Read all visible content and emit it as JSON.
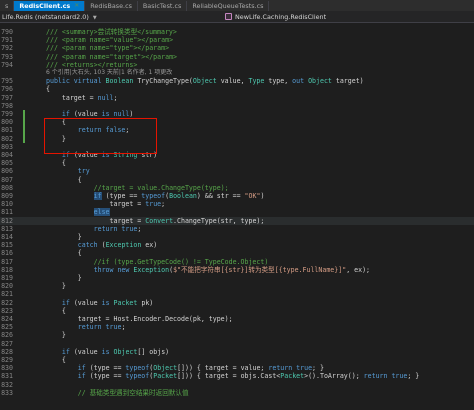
{
  "tabs": [
    {
      "label": "s",
      "active": false
    },
    {
      "label": "RedisClient.cs",
      "active": true
    },
    {
      "label": "RedisBase.cs",
      "active": false
    },
    {
      "label": "BasicTest.cs",
      "active": false
    },
    {
      "label": "ReliableQueueTests.cs",
      "active": false
    }
  ],
  "nav": {
    "project": "Life.Redis (netstandard2.0)",
    "member": "NewLife.Caching.RedisClient"
  },
  "codelens": "6 个引用|大石头, 103 天前|1 名作者, 1 项更改",
  "lines": [
    {
      "n": "790",
      "segs": [
        [
          "c",
          "/// <summary>尝试转换类型</summary>"
        ]
      ]
    },
    {
      "n": "791",
      "segs": [
        [
          "c",
          "/// <param name=\"value\"></param>"
        ]
      ]
    },
    {
      "n": "792",
      "segs": [
        [
          "c",
          "/// <param name=\"type\"></param>"
        ]
      ]
    },
    {
      "n": "793",
      "segs": [
        [
          "c",
          "/// <param name=\"target\"></param>"
        ]
      ]
    },
    {
      "n": "794",
      "segs": [
        [
          "c",
          "/// <returns></returns>"
        ]
      ]
    },
    {
      "n": "",
      "segs": []
    },
    {
      "n": "795",
      "segs": [
        [
          "k",
          "public virtual "
        ],
        [
          "t",
          "Boolean"
        ],
        [
          "p",
          " TryChangeType("
        ],
        [
          "t",
          "Object"
        ],
        [
          "p",
          " value, "
        ],
        [
          "t",
          "Type"
        ],
        [
          "p",
          " type, "
        ],
        [
          "k",
          "out "
        ],
        [
          "t",
          "Object"
        ],
        [
          "p",
          " target)"
        ]
      ]
    },
    {
      "n": "796",
      "segs": [
        [
          "p",
          "{"
        ]
      ]
    },
    {
      "n": "797",
      "segs": [
        [
          "p",
          "    target = "
        ],
        [
          "k",
          "null"
        ],
        [
          "p",
          ";"
        ]
      ]
    },
    {
      "n": "798",
      "segs": []
    },
    {
      "n": "799",
      "segs": [
        [
          "p",
          "    "
        ],
        [
          "k",
          "if"
        ],
        [
          "p",
          " (value "
        ],
        [
          "k",
          "is null"
        ],
        [
          "p",
          ")"
        ]
      ]
    },
    {
      "n": "800",
      "segs": [
        [
          "p",
          "    {"
        ]
      ]
    },
    {
      "n": "801",
      "segs": [
        [
          "p",
          "        "
        ],
        [
          "k",
          "return false"
        ],
        [
          "p",
          ";"
        ]
      ]
    },
    {
      "n": "802",
      "segs": [
        [
          "p",
          "    }"
        ]
      ]
    },
    {
      "n": "803",
      "segs": []
    },
    {
      "n": "804",
      "segs": [
        [
          "p",
          "    "
        ],
        [
          "k",
          "if"
        ],
        [
          "p",
          " (value "
        ],
        [
          "k",
          "is"
        ],
        [
          "p",
          " "
        ],
        [
          "t",
          "String"
        ],
        [
          "p",
          " str)"
        ]
      ]
    },
    {
      "n": "805",
      "segs": [
        [
          "p",
          "    {"
        ]
      ]
    },
    {
      "n": "806",
      "segs": [
        [
          "p",
          "        "
        ],
        [
          "k",
          "try"
        ]
      ]
    },
    {
      "n": "807",
      "segs": [
        [
          "p",
          "        {"
        ]
      ]
    },
    {
      "n": "808",
      "segs": [
        [
          "p",
          "            "
        ],
        [
          "c",
          "//target = value.ChangeType(type);"
        ]
      ]
    },
    {
      "n": "809",
      "segs": [
        [
          "p",
          "            "
        ],
        [
          "k",
          "if"
        ],
        [
          "p",
          " (type == "
        ],
        [
          "k",
          "typeof"
        ],
        [
          "p",
          "("
        ],
        [
          "t",
          "Boolean"
        ],
        [
          "p",
          ") && str == "
        ],
        [
          "s",
          "\"OK\""
        ],
        [
          "p",
          ")"
        ]
      ]
    },
    {
      "n": "810",
      "segs": [
        [
          "p",
          "                target = "
        ],
        [
          "k",
          "true"
        ],
        [
          "p",
          ";"
        ]
      ]
    },
    {
      "n": "811",
      "segs": [
        [
          "p",
          "            "
        ],
        [
          "k",
          "else"
        ]
      ]
    },
    {
      "n": "812",
      "segs": [
        [
          "p",
          "                target = "
        ],
        [
          "t",
          "Convert"
        ],
        [
          "p",
          ".ChangeType(str, type);"
        ]
      ]
    },
    {
      "n": "813",
      "segs": [
        [
          "p",
          "            "
        ],
        [
          "k",
          "return true"
        ],
        [
          "p",
          ";"
        ]
      ]
    },
    {
      "n": "814",
      "segs": [
        [
          "p",
          "        }"
        ]
      ]
    },
    {
      "n": "815",
      "segs": [
        [
          "p",
          "        "
        ],
        [
          "k",
          "catch"
        ],
        [
          "p",
          " ("
        ],
        [
          "t",
          "Exception"
        ],
        [
          "p",
          " ex)"
        ]
      ]
    },
    {
      "n": "816",
      "segs": [
        [
          "p",
          "        {"
        ]
      ]
    },
    {
      "n": "817",
      "segs": [
        [
          "p",
          "            "
        ],
        [
          "c",
          "//if (type.GetTypeCode() != TypeCode.Object)"
        ]
      ]
    },
    {
      "n": "818",
      "segs": [
        [
          "p",
          "            "
        ],
        [
          "k",
          "throw new "
        ],
        [
          "t",
          "Exception"
        ],
        [
          "p",
          "("
        ],
        [
          "s",
          "$\"不能把字符串[{str}]转为类型[{type.FullName}]\""
        ],
        [
          "p",
          ", ex);"
        ]
      ]
    },
    {
      "n": "819",
      "segs": [
        [
          "p",
          "        }"
        ]
      ]
    },
    {
      "n": "820",
      "segs": [
        [
          "p",
          "    }"
        ]
      ]
    },
    {
      "n": "821",
      "segs": []
    },
    {
      "n": "822",
      "segs": [
        [
          "p",
          "    "
        ],
        [
          "k",
          "if"
        ],
        [
          "p",
          " (value "
        ],
        [
          "k",
          "is"
        ],
        [
          "p",
          " "
        ],
        [
          "t",
          "Packet"
        ],
        [
          "p",
          " pk)"
        ]
      ]
    },
    {
      "n": "823",
      "segs": [
        [
          "p",
          "    {"
        ]
      ]
    },
    {
      "n": "824",
      "segs": [
        [
          "p",
          "        target = Host.Encoder.Decode(pk, type);"
        ]
      ]
    },
    {
      "n": "825",
      "segs": [
        [
          "p",
          "        "
        ],
        [
          "k",
          "return true"
        ],
        [
          "p",
          ";"
        ]
      ]
    },
    {
      "n": "826",
      "segs": [
        [
          "p",
          "    }"
        ]
      ]
    },
    {
      "n": "827",
      "segs": []
    },
    {
      "n": "828",
      "segs": [
        [
          "p",
          "    "
        ],
        [
          "k",
          "if"
        ],
        [
          "p",
          " (value "
        ],
        [
          "k",
          "is"
        ],
        [
          "p",
          " "
        ],
        [
          "t",
          "Object"
        ],
        [
          "p",
          "[] objs)"
        ]
      ]
    },
    {
      "n": "829",
      "segs": [
        [
          "p",
          "    {"
        ]
      ]
    },
    {
      "n": "830",
      "segs": [
        [
          "p",
          "        "
        ],
        [
          "k",
          "if"
        ],
        [
          "p",
          " (type == "
        ],
        [
          "k",
          "typeof"
        ],
        [
          "p",
          "("
        ],
        [
          "t",
          "Object"
        ],
        [
          "p",
          "[])) { target = value; "
        ],
        [
          "k",
          "return true"
        ],
        [
          "p",
          "; }"
        ]
      ]
    },
    {
      "n": "831",
      "segs": [
        [
          "p",
          "        "
        ],
        [
          "k",
          "if"
        ],
        [
          "p",
          " (type == "
        ],
        [
          "k",
          "typeof"
        ],
        [
          "p",
          "("
        ],
        [
          "t",
          "Packet"
        ],
        [
          "p",
          "[])) { target = objs.Cast<"
        ],
        [
          "t",
          "Packet"
        ],
        [
          "p",
          ">().ToArray(); "
        ],
        [
          "k",
          "return true"
        ],
        [
          "p",
          "; }"
        ]
      ]
    },
    {
      "n": "832",
      "segs": []
    },
    {
      "n": "833",
      "segs": [
        [
          "p",
          "        "
        ],
        [
          "c",
          "// 基础类型遇到空结果时返回默认值"
        ]
      ]
    }
  ]
}
